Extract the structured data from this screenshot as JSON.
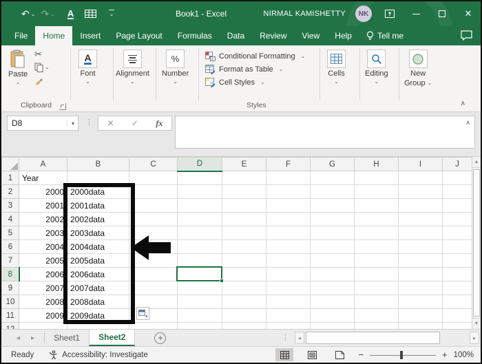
{
  "title_bar": {
    "doc_title": "Book1 - Excel",
    "user_name": "NIRMAL KAMISHETTY",
    "avatar_initials": "NK"
  },
  "menu": {
    "tabs": [
      {
        "label": "File",
        "active": false
      },
      {
        "label": "Home",
        "active": true
      },
      {
        "label": "Insert",
        "active": false
      },
      {
        "label": "Page Layout",
        "active": false
      },
      {
        "label": "Formulas",
        "active": false
      },
      {
        "label": "Data",
        "active": false
      },
      {
        "label": "Review",
        "active": false
      },
      {
        "label": "View",
        "active": false
      },
      {
        "label": "Help",
        "active": false
      }
    ],
    "tell_me": "Tell me"
  },
  "ribbon": {
    "paste": "Paste",
    "clipboard_group": "Clipboard",
    "font": "Font",
    "alignment": "Alignment",
    "number": "Number",
    "number_symbol": "%",
    "conditional_formatting": "Conditional Formatting",
    "format_as_table": "Format as Table",
    "cell_styles": "Cell Styles",
    "styles_group": "Styles",
    "cells": "Cells",
    "editing": "Editing",
    "new_group_line1": "New",
    "new_group_line2": "Group"
  },
  "formula_bar": {
    "name_box": "D8",
    "fx_label": "fx",
    "value": ""
  },
  "grid": {
    "columns": [
      "A",
      "B",
      "C",
      "D",
      "E",
      "F",
      "G",
      "H",
      "I",
      "J"
    ],
    "selected_cell": "D8",
    "selected_column": "D",
    "selected_row": "8",
    "rows": [
      {
        "n": "1",
        "A": "Year"
      },
      {
        "n": "2",
        "A": "2000",
        "B": "2000data"
      },
      {
        "n": "3",
        "A": "2001",
        "B": "2001data"
      },
      {
        "n": "4",
        "A": "2002",
        "B": "2002data"
      },
      {
        "n": "5",
        "A": "2003",
        "B": "2003data"
      },
      {
        "n": "6",
        "A": "2004",
        "B": "2004data"
      },
      {
        "n": "7",
        "A": "2005",
        "B": "2005data"
      },
      {
        "n": "8",
        "A": "2006",
        "B": "2006data"
      },
      {
        "n": "9",
        "A": "2007",
        "B": "2007data"
      },
      {
        "n": "10",
        "A": "2008",
        "B": "2008data"
      },
      {
        "n": "11",
        "A": "2009",
        "B": "2009data"
      },
      {
        "n": "12"
      }
    ]
  },
  "sheet_bar": {
    "tabs": [
      {
        "label": "Sheet1",
        "active": false
      },
      {
        "label": "Sheet2",
        "active": true
      }
    ]
  },
  "status_bar": {
    "mode": "Ready",
    "accessibility": "Accessibility: Investigate",
    "zoom_level": "100%"
  },
  "icons": {
    "undo": "↶",
    "redo": "↷",
    "chevron_down": "⌄",
    "dropdown": "▾",
    "cut": "✂",
    "dots": "⋮",
    "cancel": "✕",
    "enter": "✓",
    "collapse_ribbon": "∧",
    "expand_formula": "∧",
    "close": "✕",
    "add_sheet": "+",
    "zoom_out": "−",
    "zoom_in": "+",
    "nav_left": "◂",
    "nav_right": "▸",
    "scroll_up": "▲",
    "scroll_down": "▼",
    "underline_a": "A"
  },
  "colors": {
    "excel_green": "#217346",
    "selection_green": "#1e7145",
    "annotation": "#0b0b0b"
  }
}
